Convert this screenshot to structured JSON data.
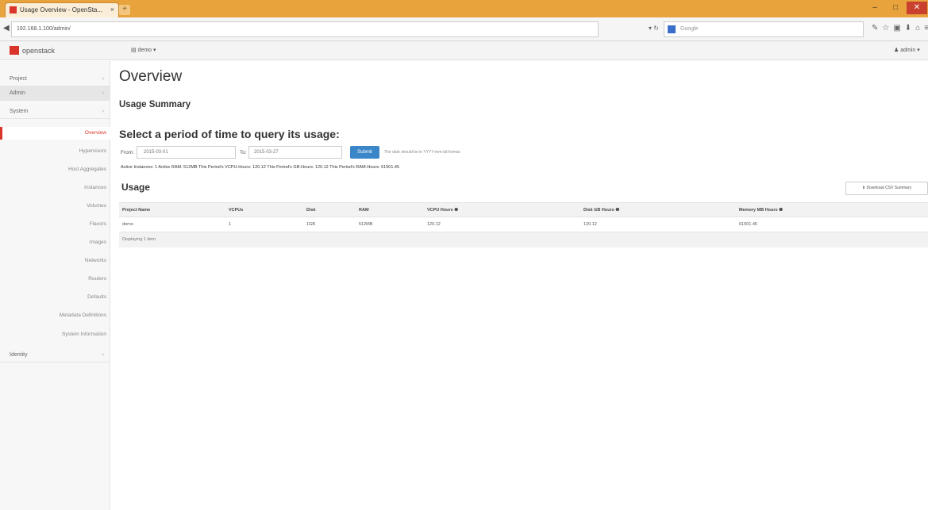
{
  "browser": {
    "tab_title": "Usage Overview - OpenSta...",
    "tab_close": "×",
    "new_tab": "+",
    "url": "192.168.1.100/admin/",
    "search_placeholder": "Google",
    "win_min": "–",
    "win_max": "□",
    "win_close": "✕"
  },
  "header": {
    "logo_text": "openstack",
    "project_dropdown": "▤ demo ▾",
    "user_dropdown": "♟ admin ▾"
  },
  "sidebar": {
    "sections": [
      {
        "label": "Project",
        "chevron": "›"
      },
      {
        "label": "Admin",
        "chevron": "›"
      },
      {
        "label": "System",
        "chevron": "›"
      },
      {
        "label": "Identity",
        "chevron": "›"
      }
    ],
    "items": [
      {
        "label": "Overview"
      },
      {
        "label": "Hypervisors"
      },
      {
        "label": "Host Aggregates"
      },
      {
        "label": "Instances"
      },
      {
        "label": "Volumes"
      },
      {
        "label": "Flavors"
      },
      {
        "label": "Images"
      },
      {
        "label": "Networks"
      },
      {
        "label": "Routers"
      },
      {
        "label": "Defaults"
      },
      {
        "label": "Metadata Definitions"
      },
      {
        "label": "System Information"
      }
    ]
  },
  "main": {
    "title": "Overview",
    "usage_summary": "Usage Summary",
    "period_heading": "Select a period of time to query its usage:",
    "from_label": "From:",
    "from_value": "2015-03-01",
    "to_label": "To:",
    "to_value": "2015-03-27",
    "submit_label": "Submit",
    "date_help": "The date should be in YYYY-mm-dd format.",
    "summary_line": "Active Instances: 1 Active RAM: 512MB This Period's VCPU-Hours: 120.12 This Period's GB-Hours: 120.12 This Period's RAM-Hours: 61501.45",
    "usage_heading": "Usage",
    "download_csv": "⬇ Download CSV Summary",
    "table": {
      "headers": [
        "Project Name",
        "VCPUs",
        "Disk",
        "RAM",
        "VCPU Hours ❶",
        "Disk GB Hours ❶",
        "Memory MB Hours ❶"
      ],
      "rows": [
        [
          "demo",
          "1",
          "1GB",
          "512MB",
          "120.12",
          "120.12",
          "61501.45"
        ]
      ],
      "footer": "Displaying 1 item"
    }
  }
}
